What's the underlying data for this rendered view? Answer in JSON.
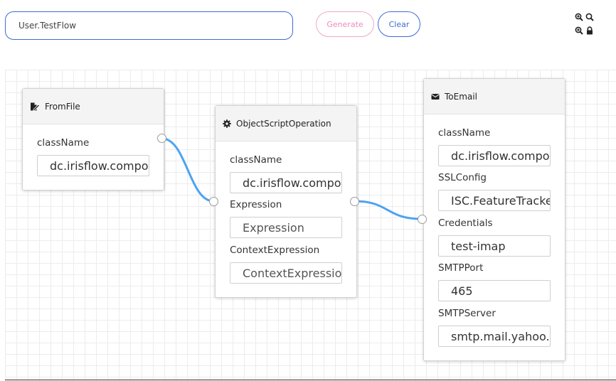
{
  "toolbar": {
    "flow_name_value": "User.TestFlow",
    "generate_label": "Generate",
    "clear_label": "Clear",
    "icons": [
      "zoom-in-icon",
      "zoom-out-icon",
      "zoom-reset-icon",
      "lock-icon"
    ]
  },
  "colors": {
    "accent": "#3f6bd6",
    "generate": "#ef8bb8",
    "wire": "#4da3f2"
  },
  "nodes": {
    "fromfile": {
      "title": "FromFile",
      "icon": "file-edit-icon",
      "fields": [
        {
          "label": "className",
          "value": "dc.irisflow.components.misc.FileReaderOperation"
        }
      ]
    },
    "objectscript": {
      "title": "ObjectScriptOperation",
      "icon": "gear-icon",
      "fields": [
        {
          "label": "className",
          "value": "dc.irisflow.components.misc.ObjectScriptOperation"
        },
        {
          "label": "Expression",
          "value": "",
          "placeholder": "Expression"
        },
        {
          "label": "ContextExpression",
          "value": "",
          "placeholder": "ContextExpression"
        }
      ]
    },
    "toemail": {
      "title": "ToEmail",
      "icon": "envelope-icon",
      "fields": [
        {
          "label": "className",
          "value": "dc.irisflow.components.misc.EmailOperation"
        },
        {
          "label": "SSLConfig",
          "value": "ISC.FeatureTracker.SSL.Config"
        },
        {
          "label": "Credentials",
          "value": "test-imap"
        },
        {
          "label": "SMTPPort",
          "value": "465"
        },
        {
          "label": "SMTPServer",
          "value": "smtp.mail.yahoo.com"
        }
      ]
    }
  }
}
